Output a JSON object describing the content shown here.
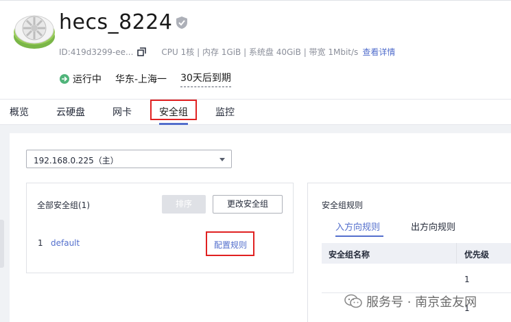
{
  "instance": {
    "name": "hecs_8224",
    "id_text": "ID:419d3299-ee...",
    "specs": "CPU 1核 | 内存 1GiB | 系统盘 40GiB | 带宽 1Mbit/s",
    "details_link": "查看详情",
    "status": "运行中",
    "region": "华东-上海一",
    "expiry": "30天后到期"
  },
  "tabs": [
    {
      "label": "概览"
    },
    {
      "label": "云硬盘"
    },
    {
      "label": "网卡"
    },
    {
      "label": "安全组",
      "active": true
    },
    {
      "label": "监控"
    }
  ],
  "nic_select": {
    "value": "192.168.0.225（主）"
  },
  "security_groups": {
    "title": "全部安全组(1)",
    "sort_button": "排序",
    "change_button": "更改安全组",
    "items": [
      {
        "index": "1",
        "name": "default",
        "action": "配置规则"
      }
    ]
  },
  "rules": {
    "title": "安全组规则",
    "tabs": [
      {
        "label": "入方向规则",
        "active": true
      },
      {
        "label": "出方向规则"
      }
    ],
    "columns": [
      "安全组名称",
      "优先级"
    ],
    "rows": [
      {
        "priority": "1"
      },
      {
        "priority": "1"
      }
    ]
  },
  "watermark": "服务号 · 南京金友网",
  "icons": {
    "logo": "server-logo-icon",
    "verified": "shield-check-icon",
    "copy": "copy-icon",
    "status": "running-status-icon",
    "dropdown": "chevron-down-icon",
    "watermark": "wechat-icon"
  },
  "colors": {
    "accent": "#526ecc",
    "highlight": "#e02020",
    "running": "#50b47a"
  }
}
